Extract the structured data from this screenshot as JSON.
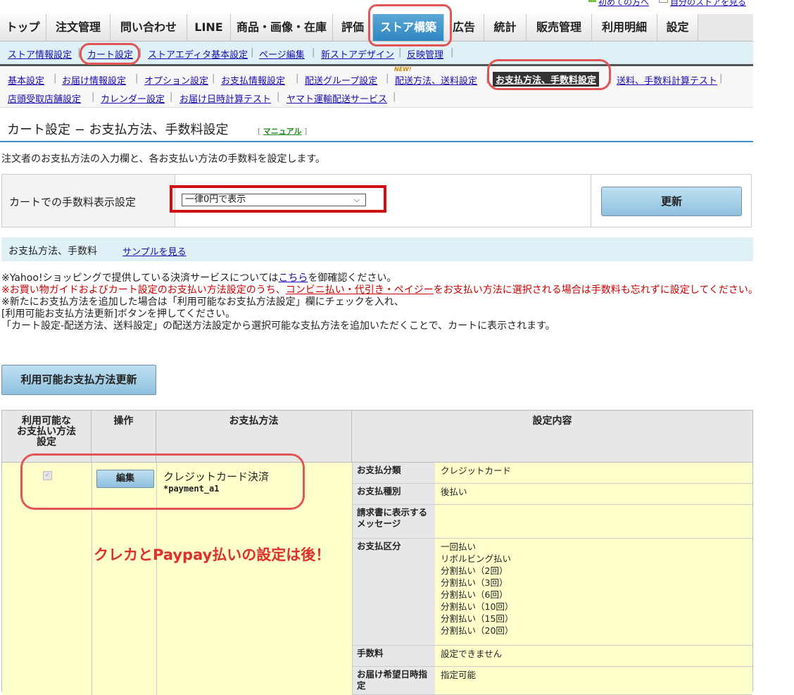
{
  "utility": {
    "first_time": "初めての方へ",
    "my_store": "自分のストアを見る"
  },
  "tabs": [
    {
      "label": "トップ"
    },
    {
      "label": "注文管理"
    },
    {
      "label": "問い合わせ"
    },
    {
      "label": "LINE"
    },
    {
      "label": "商品・画像・在庫"
    },
    {
      "label": "評価"
    },
    {
      "label": "ストア構築"
    },
    {
      "label": "広告"
    },
    {
      "label": "統計"
    },
    {
      "label": "販売管理"
    },
    {
      "label": "利用明細"
    },
    {
      "label": "設定"
    }
  ],
  "subnav": [
    {
      "label": "ストア情報設定"
    },
    {
      "label": "カート設定"
    },
    {
      "label": "ストアエディタ基本設定"
    },
    {
      "label": "ページ編集"
    },
    {
      "label": "新ストアデザイン"
    },
    {
      "label": "反映管理"
    }
  ],
  "nav3": [
    {
      "label": "基本設定"
    },
    {
      "label": "お届け情報設定"
    },
    {
      "label": "オプション設定"
    },
    {
      "label": "お支払情報設定"
    },
    {
      "label": "配送グループ設定"
    },
    {
      "label": "配送方法、送料設定"
    },
    {
      "label": "お支払方法、手数料設定"
    },
    {
      "label": "送料、手数料計算テスト"
    },
    {
      "label": "店頭受取店舗設定"
    },
    {
      "label": "カレンダー設定"
    },
    {
      "label": "お届け日時計算テスト"
    },
    {
      "label": "ヤマト運輸配送サービス"
    }
  ],
  "new_badge": "NEW!",
  "page": {
    "title": "カート設定 − お支払方法、手数料設定",
    "manual": "マニュアル",
    "description": "注文者のお支払方法の入力欄と、各お支払い方法の手数料を設定します。"
  },
  "fee_display": {
    "label": "カートでの手数料表示設定",
    "selected": "一律0円で表示",
    "update_button": "更新"
  },
  "section": {
    "title": "お支払方法、手数料",
    "sample_link": "サンプルを見る"
  },
  "notes": {
    "line1_a": "※Yahoo!ショッピングで提供している決済サービスについては",
    "line1_link": "こちら",
    "line1_b": "を御確認ください。",
    "line2_a": "※お買い物ガイドおよびカート設定のお支払い方法設定のうち、",
    "line2_link": "コンビニ払い・代引き・ペイジー",
    "line2_b": "をお支払い方法に選択される場合は手数料も忘れずに設定してください。",
    "line3": "※新たにお支払方法を追加した場合は「利用可能なお支払方法設定」欄にチェックを入れ、",
    "line4": "[利用可能お支払方法更新]ボタンを押してください。",
    "line5": "「カート設定-配送方法、送料設定」の配送方法設定から選択可能な支払方法を追加いただくことで、カートに表示されます。"
  },
  "avail_button": "利用可能お支払方法更新",
  "table": {
    "headers": {
      "avail": "利用可能な\nお支払い方法\n設定",
      "op": "操作",
      "method": "お支払方法",
      "detail": "設定内容"
    },
    "row": {
      "edit_button": "編集",
      "method_name": "クレジットカード決済",
      "method_code": "*payment_a1",
      "details": [
        {
          "k": "お支払分類",
          "v": "クレジットカード"
        },
        {
          "k": "お支払種別",
          "v": "後払い"
        },
        {
          "k": "請求書に表示するメッセージ",
          "v": ""
        },
        {
          "k": "お支払区分",
          "v": "一回払い\nリボルビング払い\n分割払い（2回）\n分割払い（3回）\n分割払い（6回）\n分割払い（10回）\n分割払い（15回）\n分割払い（20回）"
        },
        {
          "k": "手数料",
          "v": "設定できません"
        },
        {
          "k": "お届け希望日時指定",
          "v": "指定可能"
        }
      ]
    }
  },
  "annotation": "クレカとPaypay払いの設定は後！",
  "colors": {
    "accent_blue": "#2f86c1",
    "annotation_red": "#e25555",
    "row_bg": "#ffffcc"
  }
}
